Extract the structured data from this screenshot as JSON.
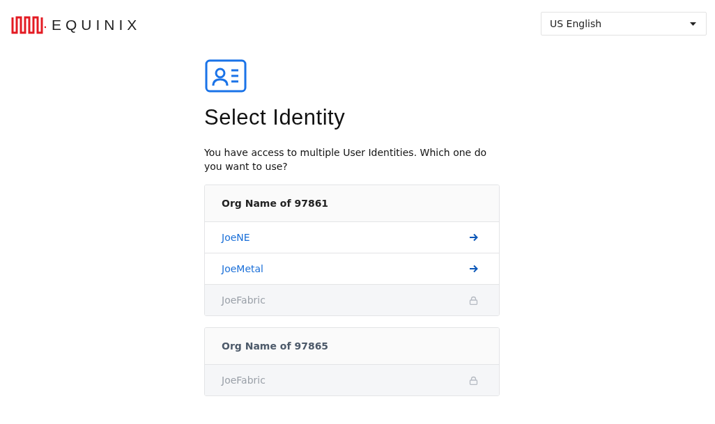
{
  "header": {
    "brand": "EQUINIX",
    "language": {
      "value": "US English"
    }
  },
  "title": "Select Identity",
  "intro": "You have access to multiple User Identities. Which one do you want to use?",
  "orgs": [
    {
      "name": "Org Name of 97861",
      "disabled": false,
      "identities": [
        {
          "name": "JoeNE",
          "disabled": false
        },
        {
          "name": "JoeMetal",
          "disabled": false
        },
        {
          "name": "JoeFabric",
          "disabled": true
        }
      ]
    },
    {
      "name": "Org Name of 97865",
      "disabled": true,
      "identities": [
        {
          "name": "JoeFabric",
          "disabled": true
        }
      ]
    }
  ]
}
